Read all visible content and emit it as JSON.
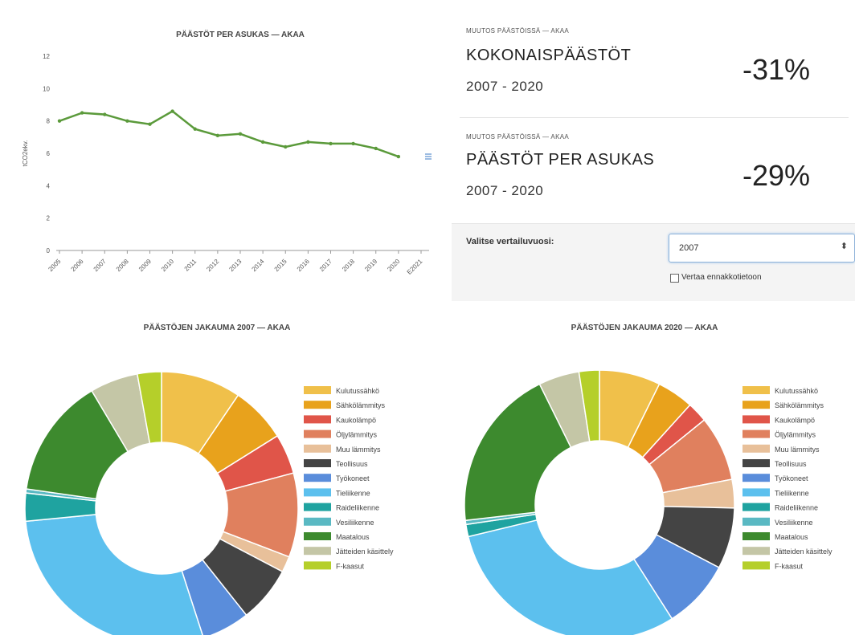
{
  "colors": {
    "line": "#5b9a3b",
    "kulutussahko": "#f0c04a",
    "sahkolammitys": "#e8a21c",
    "kaukolampo": "#e05549",
    "oljylammitys": "#e0805e",
    "muu_lammitys": "#e8c09a",
    "teollisuus": "#444444",
    "tyokoneet": "#5a8ddb",
    "tieliikenne": "#5cc0ee",
    "raideliikenne": "#1fa3a0",
    "vesiliikenne": "#5ab9c3",
    "maatalous": "#3d8a2e",
    "jatteiden_kasittely": "#c4c6a6",
    "f_kaasut": "#b5cf2a"
  },
  "stats": [
    {
      "eyebrow": "MUUTOS PÄÄSTÖISSÄ — AKAA",
      "title": "KOKONAISPÄÄSTÖT",
      "period": "2007 - 2020",
      "value": "-31%"
    },
    {
      "eyebrow": "MUUTOS PÄÄSTÖISSÄ — AKAA",
      "title": "PÄÄSTÖT PER ASUKAS",
      "period": "2007 - 2020",
      "value": "-29%"
    }
  ],
  "controls": {
    "year_label": "Valitse vertailuvuosi:",
    "year_selected": "2007",
    "select_arrow": "⬍",
    "compare_label": "Vertaa ennakkotietoon"
  },
  "legend_icon": "menu-icon",
  "chart_data": [
    {
      "type": "line",
      "title": "PÄÄSTÖT PER ASUKAS — AKAA",
      "ylabel": "tCO2ekv.",
      "xlabel": "",
      "x": [
        "2005",
        "2006",
        "2007",
        "2008",
        "2009",
        "2010",
        "2011",
        "2012",
        "2013",
        "2014",
        "2015",
        "2016",
        "2017",
        "2018",
        "2019",
        "2020",
        "E2021"
      ],
      "series": [
        {
          "values": [
            8.0,
            8.5,
            8.4,
            8.0,
            7.8,
            8.6,
            7.5,
            7.1,
            7.2,
            6.7,
            6.4,
            6.7,
            6.6,
            6.6,
            6.3,
            5.8
          ]
        }
      ],
      "ylim": [
        0,
        12
      ],
      "yticks": [
        0,
        2,
        4,
        6,
        8,
        10,
        12
      ],
      "grid": false
    },
    {
      "type": "pie",
      "title": "PÄÄSTÖJEN JAKAUMA 2007 — AKAA",
      "donut": true,
      "legend_position": "right",
      "categories": [
        "Kulutussähkö",
        "Sähkölämmitys",
        "Kaukolämpö",
        "Öljylämmitys",
        "Muu lämmitys",
        "Teollisuus",
        "Työkoneet",
        "Tieliikenne",
        "Raideliikenne",
        "Vesiliikenne",
        "Maatalous",
        "Jätteiden käsittely",
        "F-kaasut"
      ],
      "values": [
        10.0,
        7.0,
        5.0,
        10.5,
        2.0,
        7.0,
        6.0,
        30.0,
        3.5,
        0.5,
        15.0,
        6.0,
        3.0
      ]
    },
    {
      "type": "pie",
      "title": "PÄÄSTÖJEN JAKAUMA 2020 — AKAA",
      "donut": true,
      "legend_position": "right",
      "categories": [
        "Kulutussähkö",
        "Sähkölämmitys",
        "Kaukolämpö",
        "Öljylämmitys",
        "Muu lämmitys",
        "Teollisuus",
        "Työkoneet",
        "Tieliikenne",
        "Raideliikenne",
        "Vesiliikenne",
        "Maatalous",
        "Jätteiden käsittely",
        "F-kaasut"
      ],
      "values": [
        7.5,
        4.5,
        2.5,
        8.0,
        3.5,
        7.5,
        8.5,
        31.0,
        1.5,
        0.5,
        20.0,
        5.0,
        2.5
      ]
    }
  ]
}
